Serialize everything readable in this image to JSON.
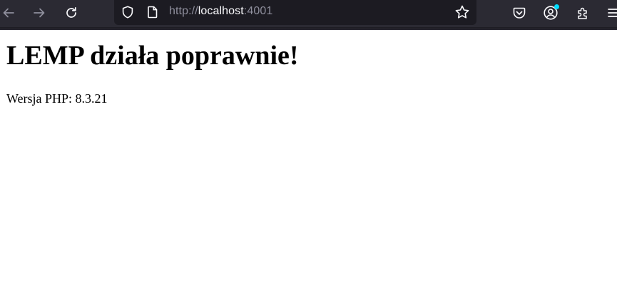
{
  "browser": {
    "url_scheme": "http://",
    "url_host": "localhost",
    "url_port": ":4001",
    "colors": {
      "toolbar": "#2b2a33",
      "urlbar": "#1c1b22",
      "icon": "#fbfbfe",
      "icon_disabled": "#8f8f9d",
      "badge": "#00ddff"
    },
    "icons": [
      "back-arrow-icon",
      "forward-arrow-icon",
      "reload-icon",
      "shield-icon",
      "page-icon",
      "star-icon",
      "pocket-icon",
      "account-icon",
      "extensions-icon",
      "menu-icon"
    ]
  },
  "page": {
    "heading": "LEMP działa poprawnie!",
    "php_version_label": "Wersja PHP: 8.3.21"
  }
}
